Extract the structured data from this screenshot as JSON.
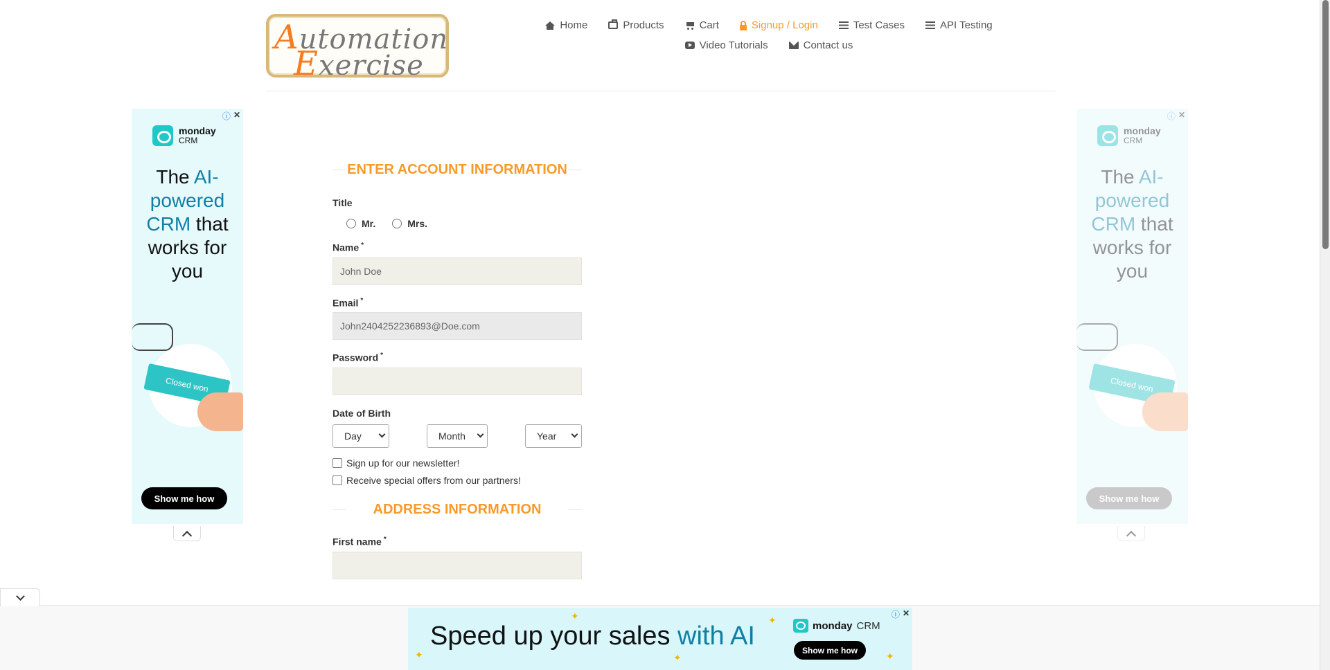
{
  "logo": {
    "line1_first": "A",
    "line1_rest": "utomation",
    "line2_first": "E",
    "line2_rest": "xercise"
  },
  "nav": {
    "row1": [
      {
        "label": "Home",
        "icon": "home-icon"
      },
      {
        "label": "Products",
        "icon": "briefcase-icon"
      },
      {
        "label": "Cart",
        "icon": "cart-icon"
      },
      {
        "label": "Signup / Login",
        "icon": "lock-icon",
        "active": true
      },
      {
        "label": "Test Cases",
        "icon": "list-icon"
      },
      {
        "label": "API Testing",
        "icon": "list-icon"
      }
    ],
    "row2": [
      {
        "label": "Video Tutorials",
        "icon": "youtube-icon"
      },
      {
        "label": "Contact us",
        "icon": "envelope-icon"
      }
    ]
  },
  "form": {
    "account_title": "ENTER ACCOUNT INFORMATION",
    "title_label": "Title",
    "title_options": [
      "Mr.",
      "Mrs."
    ],
    "name_label": "Name",
    "name_value": "John Doe",
    "email_label": "Email",
    "email_value": "John2404252236893@Doe.com",
    "password_label": "Password",
    "password_value": "",
    "dob_label": "Date of Birth",
    "dob_day": "Day",
    "dob_month": "Month",
    "dob_year": "Year",
    "newsletter_label": "Sign up for our newsletter!",
    "offers_label": "Receive special offers from our partners!",
    "address_title": "ADDRESS INFORMATION",
    "first_name_label": "First name",
    "first_name_value": "",
    "required_mark": "*"
  },
  "side_ad": {
    "brand": "monday",
    "brand_sub": "CRM",
    "headline_pre": "The ",
    "headline_hl": "AI-powered CRM",
    "headline_post": " that works for you",
    "card_text": "Closed won",
    "cta": "Show me how",
    "info": "ⓘ",
    "close": "✕"
  },
  "bottom_ad": {
    "headline_pre": "Speed up your sales ",
    "headline_hl": "with AI",
    "brand": "monday",
    "brand_sub": "CRM",
    "cta": "Show me how",
    "info": "ⓘ",
    "close": "✕"
  },
  "colors": {
    "accent": "#f89a29",
    "ad_bg": "#e6fafc",
    "ad_teal": "#2cc4c4"
  }
}
